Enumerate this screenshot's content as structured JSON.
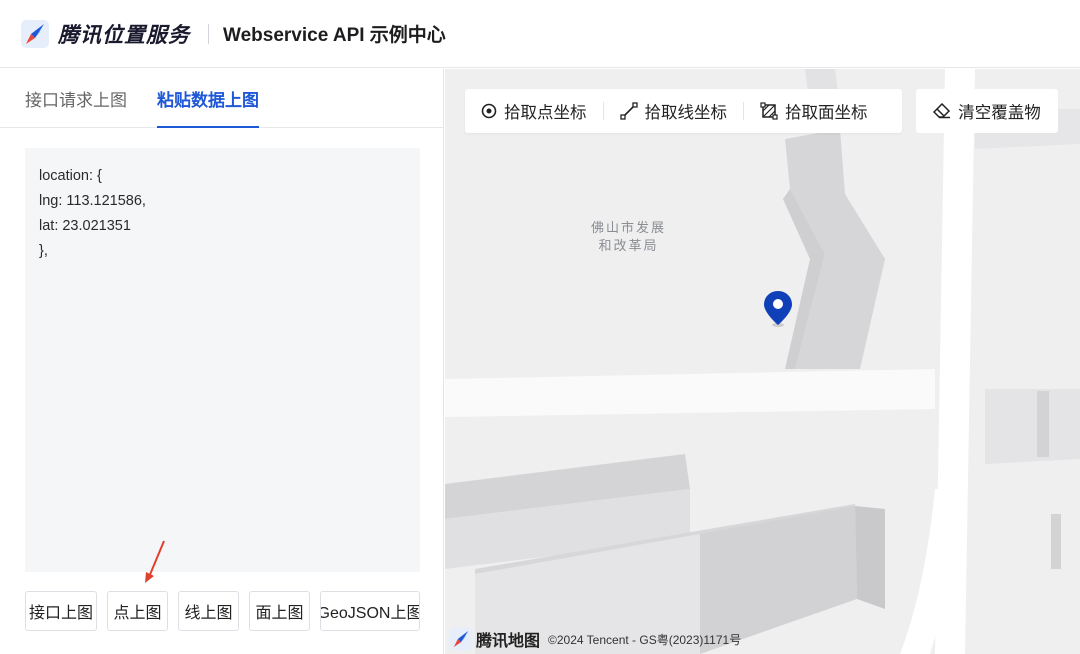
{
  "header": {
    "brand": "腾讯位置服务",
    "title": "Webservice API 示例中心",
    "logo_icon": "tencent-compass-logo-icon"
  },
  "tabs": [
    {
      "label": "接口请求上图",
      "active": false
    },
    {
      "label": "粘贴数据上图",
      "active": true
    }
  ],
  "editor": {
    "value": "location: {\nlng: 113.121586,\nlat: 23.021351\n},"
  },
  "buttons": [
    {
      "label": "接口上图"
    },
    {
      "label": "点上图"
    },
    {
      "label": "线上图"
    },
    {
      "label": "面上图"
    },
    {
      "label": "GeoJSON上图"
    }
  ],
  "map": {
    "tools": [
      {
        "label": "拾取点坐标",
        "icon": "target-point-icon"
      },
      {
        "label": "拾取线坐标",
        "icon": "polyline-icon"
      },
      {
        "label": "拾取面坐标",
        "icon": "polygon-icon"
      }
    ],
    "clear_label": "清空覆盖物",
    "clear_icon": "eraser-icon",
    "poi_line1": "佛山市发展",
    "poi_line2": "和改革局",
    "marker_icon": "map-pin-icon",
    "footer_brand": "腾讯地图",
    "copyright": "©2024 Tencent - GS粤(2023)1171号",
    "marker_color": "#1040b8"
  },
  "colors": {
    "accent": "#1f58d6"
  }
}
